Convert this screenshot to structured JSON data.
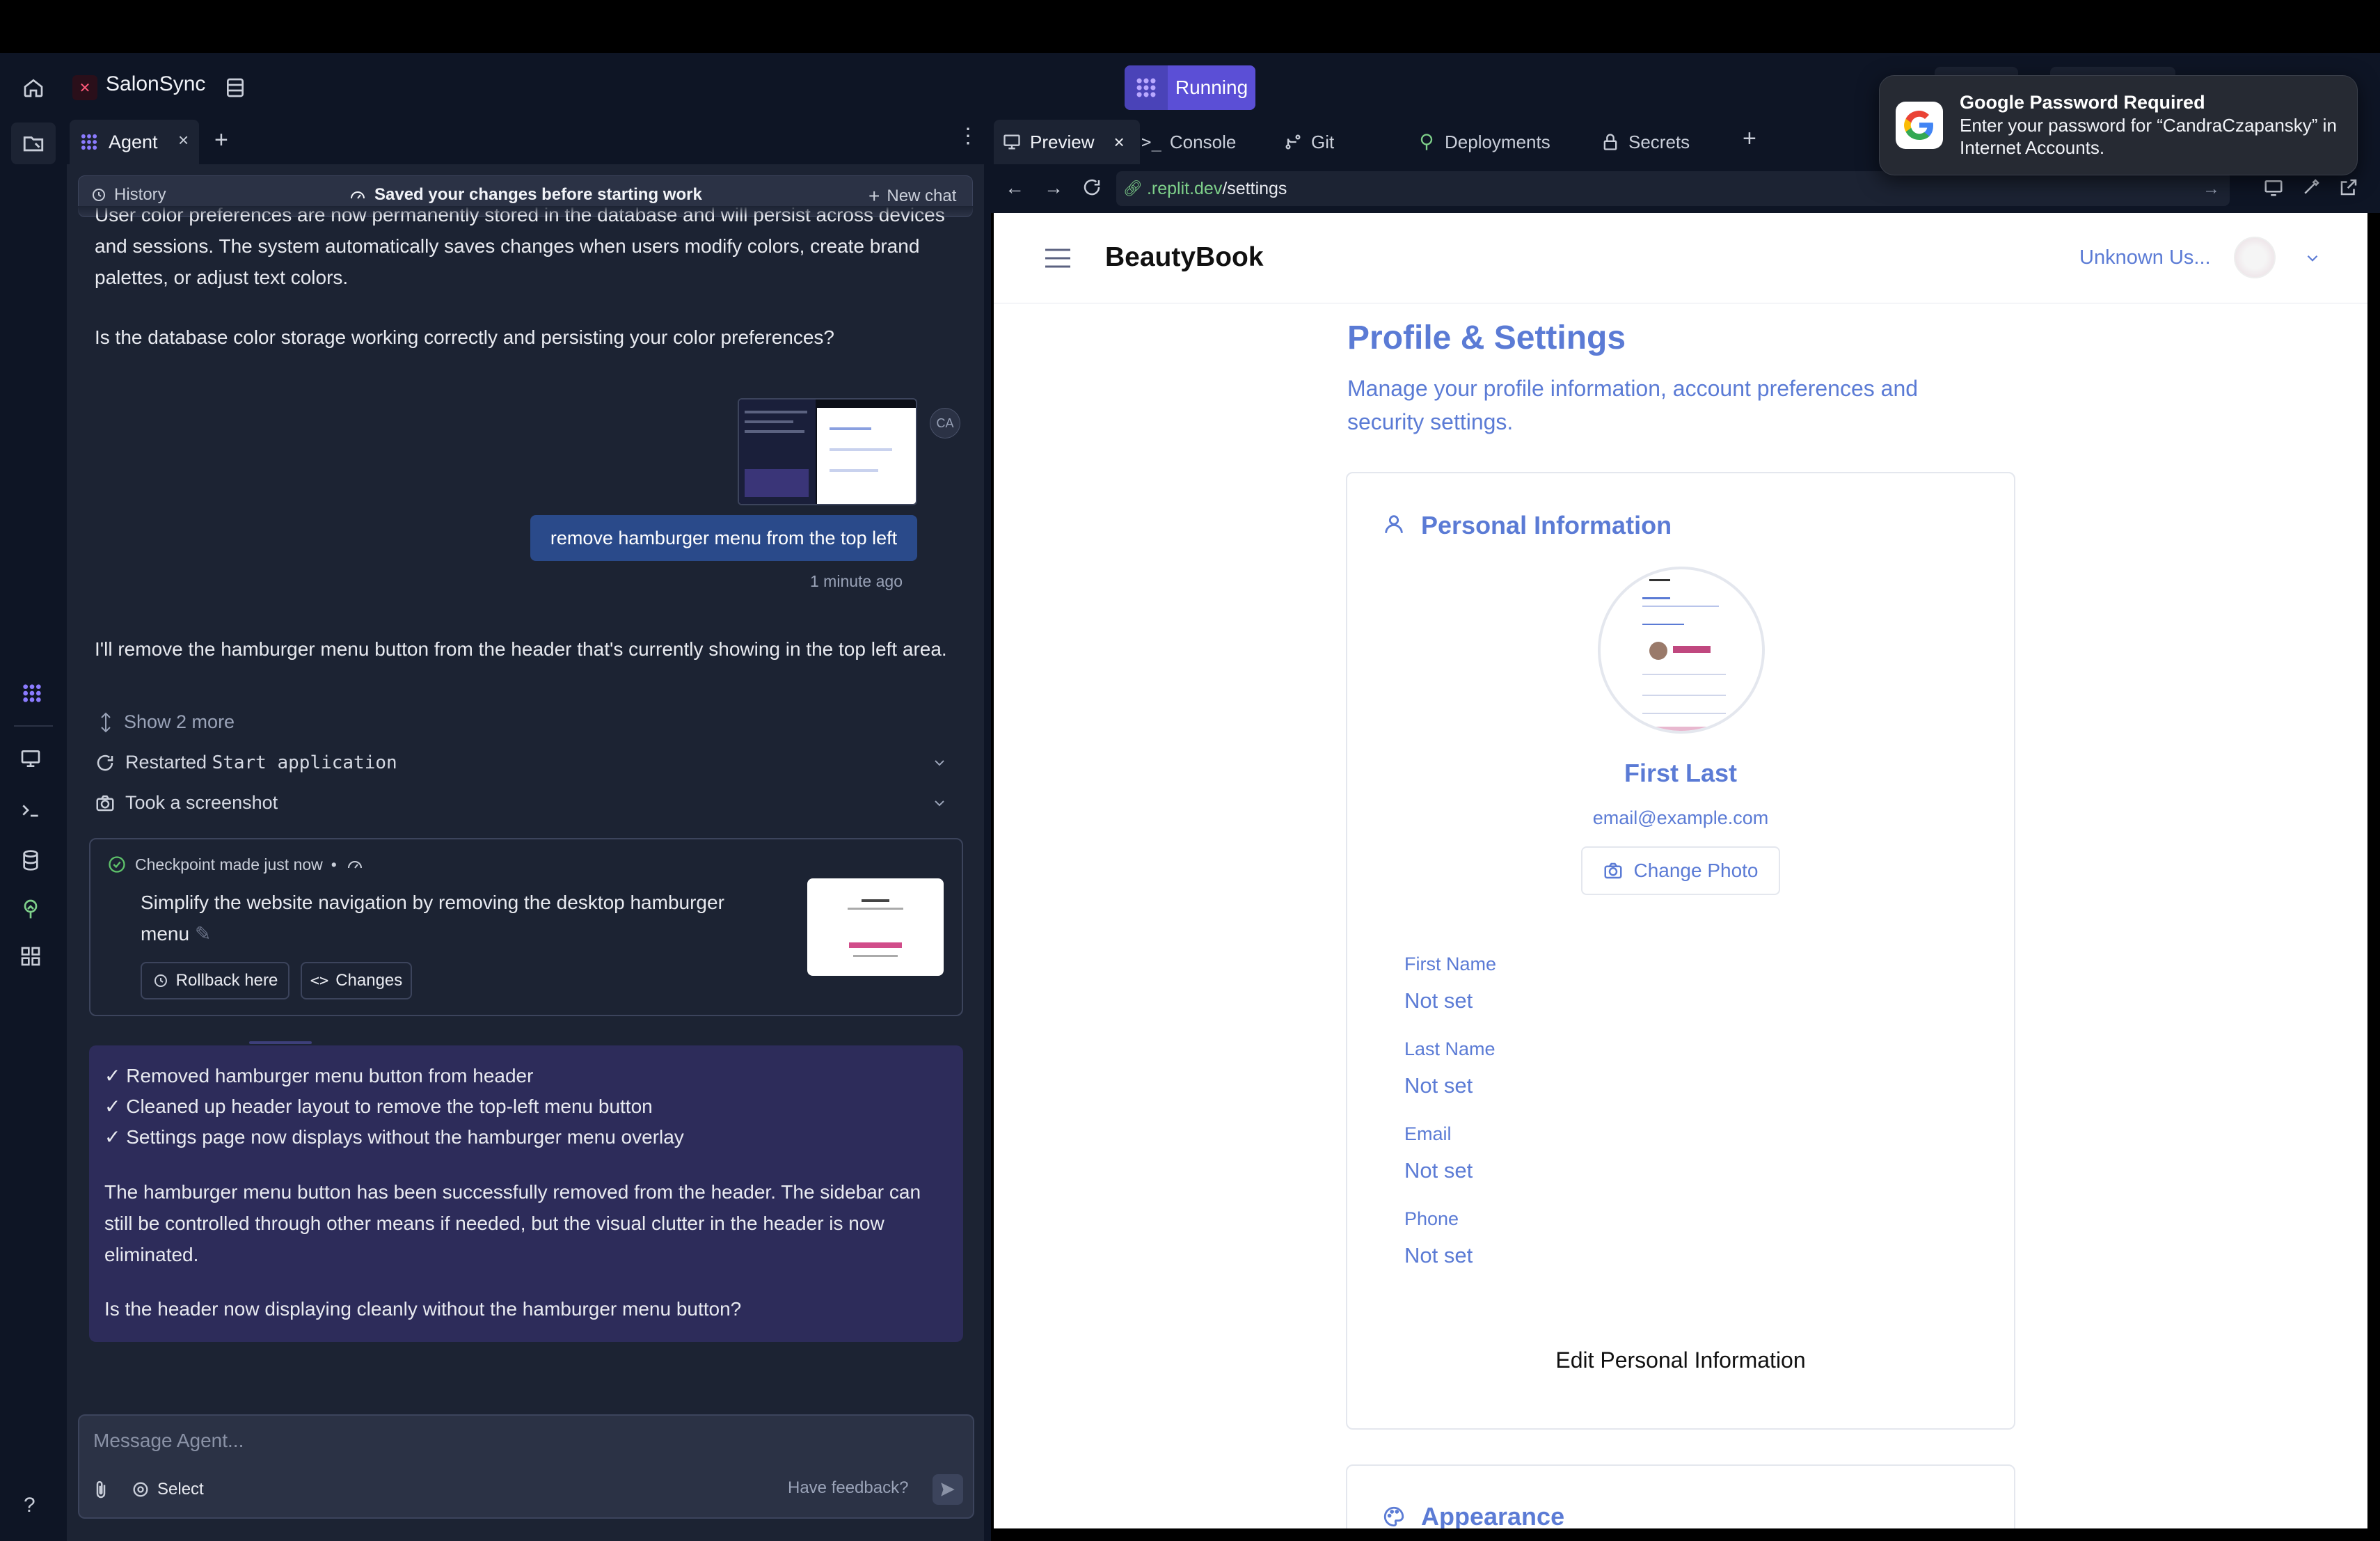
{
  "titlebar": {
    "app_name": "SalonSync",
    "run_status": "Running"
  },
  "agent": {
    "tab_label": "Agent",
    "history_label": "History",
    "saved_notice": "Saved your changes before starting work",
    "new_chat_label": "New chat",
    "msg1_partial": "User color preferences are now permanently stored in the database and will persist across devices and sessions. The system automatically saves changes when users modify colors, create brand palettes, or adjust text colors.",
    "msg1_question": "Is the database color storage working correctly and persisting your color preferences?",
    "user_avatar": "CA",
    "user_message": "remove hamburger menu from the top left",
    "user_time": "1 minute ago",
    "agent_reply": "I'll remove the hamburger menu button from the header that's currently showing in the top left area.",
    "show_more": "Show 2 more",
    "action1_prefix": "Restarted ",
    "action1_code": "Start application",
    "action2": "Took a screenshot",
    "checkpoint_label": "Checkpoint made just now",
    "checkpoint_sep": "•",
    "checkpoint_title": "Simplify the website navigation by removing the desktop hamburger menu",
    "rollback_label": "Rollback here",
    "changes_label": "Changes",
    "summary_items": [
      "✓ Removed hamburger menu button from header",
      "✓ Cleaned up header layout to remove the top-left menu button",
      "✓ Settings page now displays without the hamburger menu overlay"
    ],
    "summary_body": "The hamburger menu button has been successfully removed from the header. The sidebar can still be controlled through other means if needed, but the visual clutter in the header is now eliminated.",
    "summary_question": "Is the header now displaying cleanly without the hamburger menu button?",
    "input_placeholder": "Message Agent...",
    "select_label": "Select",
    "feedback_label": "Have feedback?"
  },
  "preview_tabs": [
    {
      "label": "Preview"
    },
    {
      "label": "Console"
    },
    {
      "label": "Git"
    },
    {
      "label": "Deployments"
    },
    {
      "label": "Secrets"
    }
  ],
  "url": {
    "host": ".replit.dev",
    "path": "/settings"
  },
  "site": {
    "brand": "BeautyBook",
    "user_label": "Unknown Us...",
    "page_title": "Profile & Settings",
    "page_subtitle": "Manage your profile information, account preferences and security settings.",
    "section_title": "Personal Information",
    "profile_name": "First Last",
    "profile_email": "email@example.com",
    "change_photo_label": "Change Photo",
    "fields": [
      {
        "label": "First Name",
        "value": "Not set"
      },
      {
        "label": "Last Name",
        "value": "Not set"
      },
      {
        "label": "Email",
        "value": "Not set"
      },
      {
        "label": "Phone",
        "value": "Not set"
      }
    ],
    "edit_button": "Edit Personal Information",
    "appearance_title": "Appearance"
  },
  "notification": {
    "title": "Google Password Required",
    "body": "Enter your password for “CandraCzapansky” in Internet Accounts."
  },
  "colors": {
    "accent": "#5b4fd6",
    "site_blue": "#5b7bd5",
    "panel_bg": "#1c2333",
    "chrome_bg": "#0e1525",
    "agent_summary_bg": "#2d2c5a"
  }
}
